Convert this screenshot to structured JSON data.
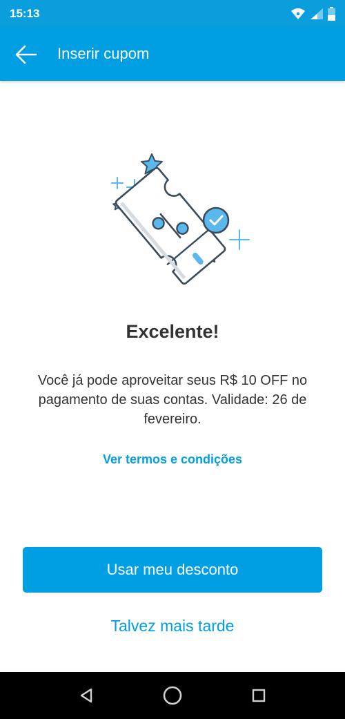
{
  "status_bar": {
    "time": "15:13",
    "icons": [
      "wifi-icon",
      "signal-icon",
      "battery-icon"
    ]
  },
  "app_bar": {
    "title": "Inserir cupom",
    "back_icon": "arrow-left-icon"
  },
  "main": {
    "illustration": "coupon-check-illustration",
    "headline": "Excelente!",
    "description": "Você já pode aproveitar seus R$ 10 OFF no pagamento de suas contas. Validade: 26 de fevereiro.",
    "terms_link": "Ver termos e condições",
    "primary_button": "Usar meu desconto",
    "secondary_link": "Talvez mais tarde"
  },
  "nav_bar": {
    "icons": [
      "back-triangle-icon",
      "home-circle-icon",
      "recents-square-icon"
    ]
  },
  "colors": {
    "primary": "#009ee3",
    "status_bar": "#0a9fdc",
    "text": "#333333",
    "illustration_blue": "#5bb8ec",
    "illustration_line": "#3b4b5a"
  }
}
